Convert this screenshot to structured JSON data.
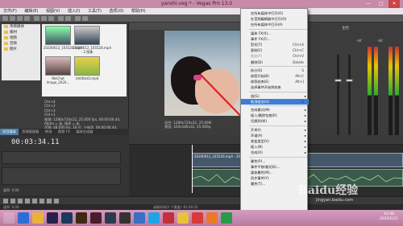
{
  "window": {
    "title": "yanshi.veg * - Vegas Pro 13.0",
    "minimize": "—",
    "maximize": "□",
    "close": "✕"
  },
  "menubar": [
    "文件(F)",
    "编辑(E)",
    "视图(V)",
    "插入(I)",
    "工具(T)",
    "选项(O)",
    "帮助(H)"
  ],
  "explorer": {
    "tree": [
      "项目媒体",
      "素材",
      "视频",
      "音频",
      "图片"
    ],
    "thumbs": [
      {
        "label": "20200612_165526.mp4"
      },
      {
        "label": "20200612_165528.mp4 - 2 图像"
      },
      {
        "label": "WeChat Image_2020..."
      },
      {
        "label": "Untitled3.mp4"
      }
    ],
    "props": [
      "Ctrl+4",
      "Ctrl+2",
      "Ctrl+3",
      "Ctrl+1",
      "视频: 1280x720x12, 25.000 fps, 00:00:06.44, Alpha = 无, 场序 = 无",
      "音频: 48,000 Hz, 16 位, 立体声, 00:00:06.44, AAC"
    ]
  },
  "tabs": [
    {
      "label": "项目媒体",
      "active": true
    },
    {
      "label": "资源管理器",
      "active": false
    },
    {
      "label": "转场",
      "active": false
    },
    {
      "label": "视频 FX",
      "active": false
    },
    {
      "label": "媒体生成器",
      "active": false
    }
  ],
  "preview": {
    "info_line1": "项目: 1280x720x32, 25.000i",
    "info_line2": "预览: 320x180x32, 25.000p",
    "info_line3": "帧:  63",
    "info_line4": "显示: 304x180x32"
  },
  "mixer": {
    "label": "主控",
    "value_a": "-Inf.",
    "value_b": "-Inf."
  },
  "timeline": {
    "timecode": "00:03:34.11",
    "video_clip_label": "20200612_165526.mp4 - 20200612_...",
    "rate_label": "速率: 0.00"
  },
  "statusbar": {
    "left": "速率: 0.00",
    "right": "录制时间(2 个通道): 61:49:35"
  },
  "context_menu": {
    "items": [
      {
        "label": "在所有媒体中打开(O)",
        "shortcut": "",
        "submenu": false,
        "disabled": false,
        "highlight": false
      },
      {
        "label": "在音频编辑器中打开(O)",
        "shortcut": "",
        "submenu": false,
        "disabled": false,
        "highlight": false
      },
      {
        "label": "在所有媒体中打开(A)",
        "shortcut": "",
        "submenu": false,
        "disabled": false,
        "highlight": false
      },
      {
        "sep": true
      },
      {
        "label": "媒体 FX(X)...",
        "shortcut": "",
        "submenu": false,
        "disabled": false,
        "highlight": false
      },
      {
        "label": "事件 FX(F)...",
        "shortcut": "",
        "submenu": false,
        "disabled": false,
        "highlight": false
      },
      {
        "label": "剪切(T)",
        "shortcut": "Ctrl+X",
        "submenu": false,
        "disabled": false,
        "highlight": false
      },
      {
        "label": "复制(C)",
        "shortcut": "Ctrl+C",
        "submenu": false,
        "disabled": false,
        "highlight": false
      },
      {
        "label": "粘贴(P)",
        "shortcut": "Ctrl+V",
        "submenu": false,
        "disabled": true,
        "highlight": false
      },
      {
        "label": "删除(D)",
        "shortcut": "Delete",
        "submenu": false,
        "disabled": false,
        "highlight": false
      },
      {
        "sep": true
      },
      {
        "label": "拆分(S)",
        "shortcut": "S",
        "submenu": false,
        "disabled": false,
        "highlight": false
      },
      {
        "label": "修剪开始(B)",
        "shortcut": "Alt+[",
        "submenu": false,
        "disabled": false,
        "highlight": false
      },
      {
        "label": "修剪结束(E)",
        "shortcut": "Alt+]",
        "submenu": false,
        "disabled": false,
        "highlight": false
      },
      {
        "label": "选择事件开始到结束",
        "shortcut": "",
        "submenu": false,
        "disabled": false,
        "highlight": false
      },
      {
        "sep": true
      },
      {
        "label": "组(G)",
        "shortcut": "",
        "submenu": true,
        "disabled": false,
        "highlight": false
      },
      {
        "label": "取消组合(U)",
        "shortcut": "U",
        "submenu": false,
        "disabled": false,
        "highlight": true
      },
      {
        "sep": true
      },
      {
        "label": "合成模式(M)",
        "shortcut": "",
        "submenu": true,
        "disabled": false,
        "highlight": false
      },
      {
        "label": "插入/删除包络(R)",
        "shortcut": "",
        "submenu": true,
        "disabled": false,
        "highlight": false
      },
      {
        "label": "切换到(W)",
        "shortcut": "",
        "submenu": true,
        "disabled": false,
        "highlight": false
      },
      {
        "sep": true
      },
      {
        "label": "开关(I)",
        "shortcut": "",
        "submenu": true,
        "disabled": false,
        "highlight": false
      },
      {
        "label": "声道(A)",
        "shortcut": "",
        "submenu": true,
        "disabled": false,
        "highlight": false
      },
      {
        "label": "渐变类型(V)",
        "shortcut": "",
        "submenu": true,
        "disabled": false,
        "highlight": false
      },
      {
        "label": "插入(N)",
        "shortcut": "",
        "submenu": true,
        "disabled": false,
        "highlight": false
      },
      {
        "label": "合成(O)",
        "shortcut": "",
        "submenu": true,
        "disabled": false,
        "highlight": false
      },
      {
        "sep": true
      },
      {
        "label": "属性(P)...",
        "shortcut": "",
        "submenu": false,
        "disabled": false,
        "highlight": false
      },
      {
        "label": "事件平移/裁切(E)...",
        "shortcut": "",
        "submenu": false,
        "disabled": false,
        "highlight": false
      },
      {
        "label": "媒体属性(M)...",
        "shortcut": "",
        "submenu": false,
        "disabled": false,
        "highlight": false
      },
      {
        "label": "同步事件(Y)",
        "shortcut": "",
        "submenu": false,
        "disabled": false,
        "highlight": false
      },
      {
        "label": "属性(T)...",
        "shortcut": "",
        "submenu": false,
        "disabled": false,
        "highlight": false
      }
    ]
  },
  "taskbar": {
    "time": "10:48",
    "date": "2020/6/21"
  },
  "watermark": {
    "logo": "Baidu经验",
    "url": "jingyan.baidu.com"
  },
  "colors": {
    "accent": "#3d7dd6",
    "titlebar": "#c78aa8",
    "arrow": "#e02020"
  }
}
